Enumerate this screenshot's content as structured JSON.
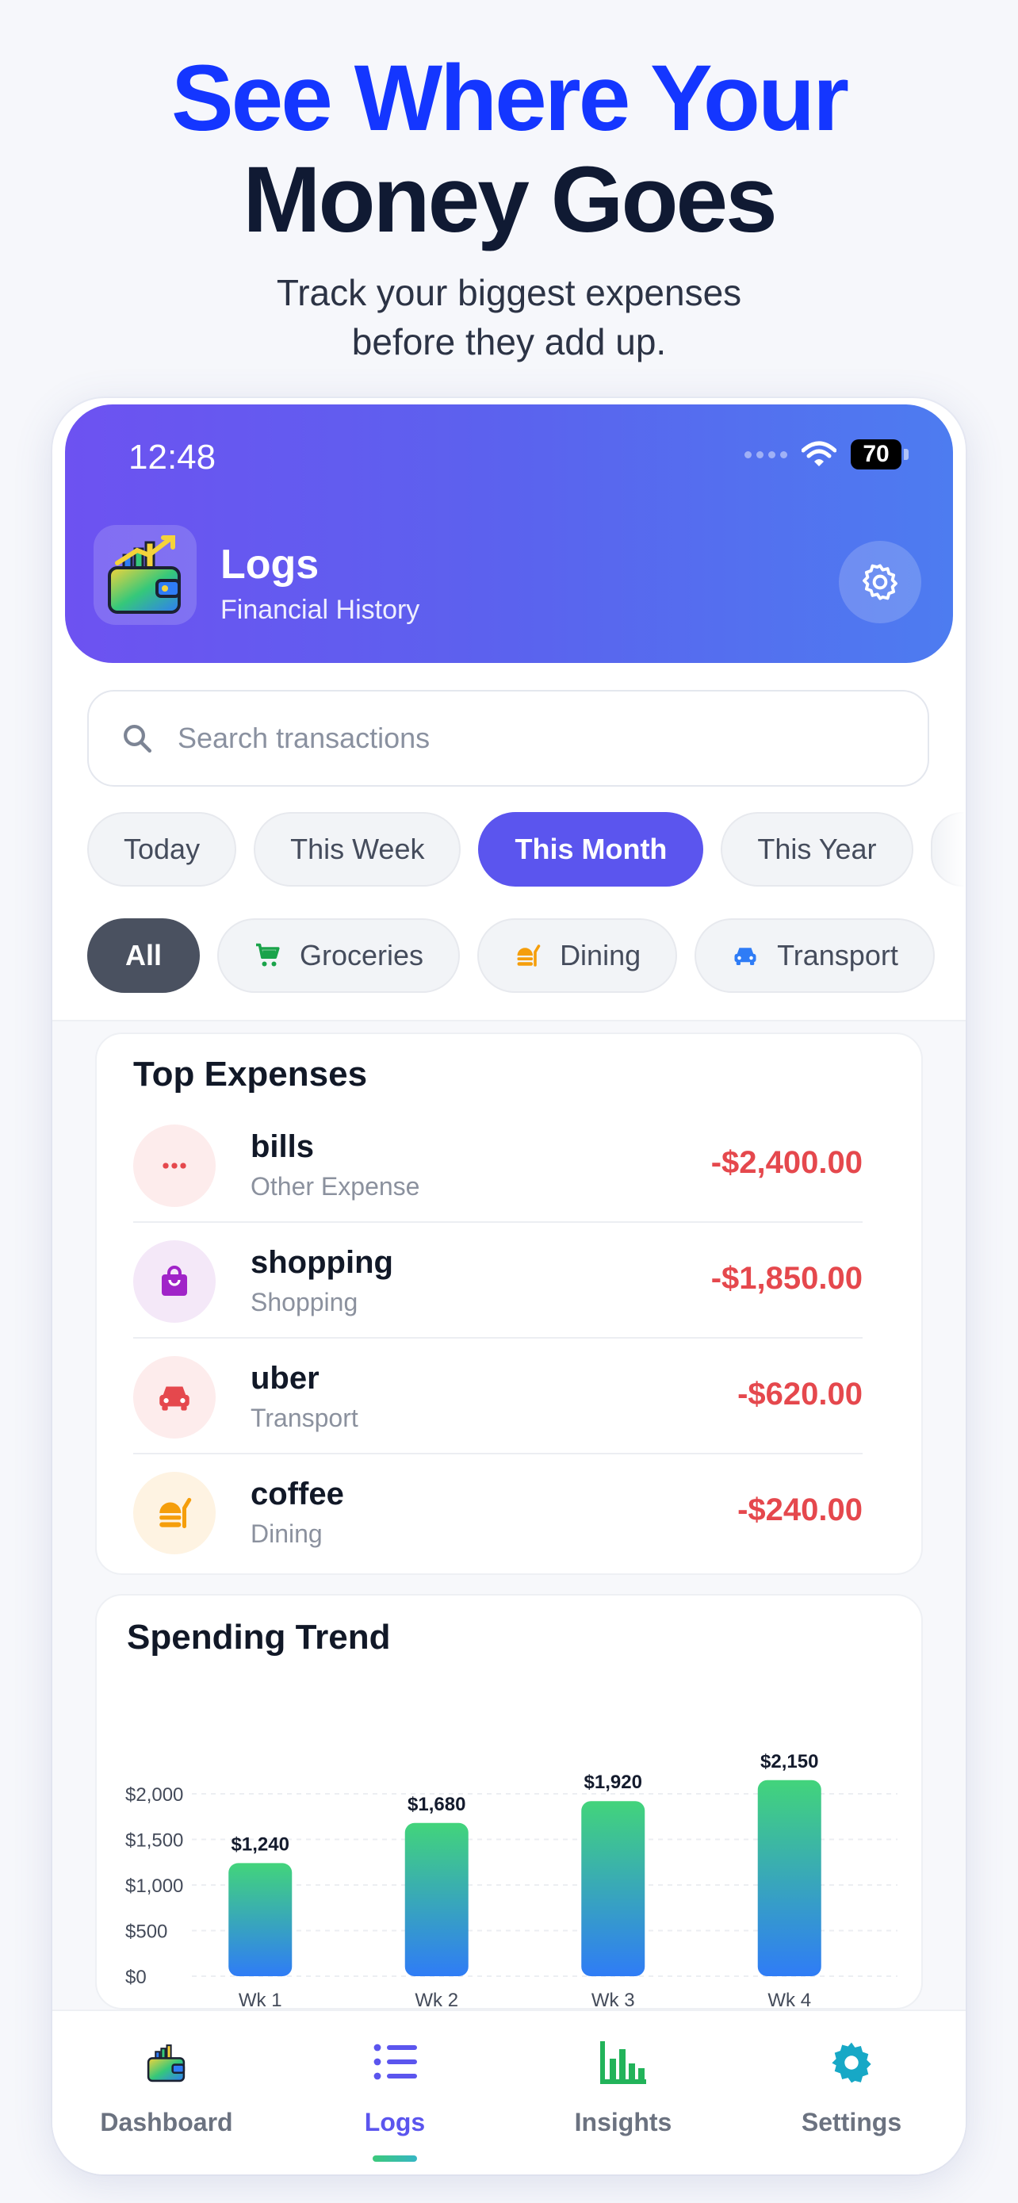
{
  "hero": {
    "line1": "See Where Your",
    "line2": "Money Goes",
    "subtitle_line1": "Track your biggest expenses",
    "subtitle_line2": "before they add up."
  },
  "status_bar": {
    "time": "12:48",
    "battery": "70"
  },
  "header": {
    "title": "Logs",
    "subtitle": "Financial History"
  },
  "search": {
    "placeholder": "Search transactions",
    "value": ""
  },
  "period_filters": [
    {
      "label": "Today",
      "active": false
    },
    {
      "label": "This Week",
      "active": false
    },
    {
      "label": "This Month",
      "active": true
    },
    {
      "label": "This Year",
      "active": false
    }
  ],
  "category_filters": [
    {
      "label": "All",
      "active": true,
      "icon": ""
    },
    {
      "label": "Groceries",
      "active": false,
      "icon": "cart-icon"
    },
    {
      "label": "Dining",
      "active": false,
      "icon": "food-icon"
    },
    {
      "label": "Transport",
      "active": false,
      "icon": "car-icon"
    }
  ],
  "top_expenses": {
    "title": "Top Expenses",
    "items": [
      {
        "name": "bills",
        "category": "Other Expense",
        "amount": "-$2,400.00",
        "icon": "more-icon",
        "icon_color": "#e5484d",
        "icon_bg": "#fdecec"
      },
      {
        "name": "shopping",
        "category": "Shopping",
        "amount": "-$1,850.00",
        "icon": "shopping-bag-icon",
        "icon_color": "#a024c8",
        "icon_bg": "#f4e8f8"
      },
      {
        "name": "uber",
        "category": "Transport",
        "amount": "-$620.00",
        "icon": "car-icon",
        "icon_color": "#e5484d",
        "icon_bg": "#fdecec"
      },
      {
        "name": "coffee",
        "category": "Dining",
        "amount": "-$240.00",
        "icon": "food-icon",
        "icon_color": "#f59e0b",
        "icon_bg": "#fef3e2"
      }
    ]
  },
  "spending_trend": {
    "title": "Spending Trend"
  },
  "chart_data": {
    "type": "bar",
    "categories": [
      "Wk 1",
      "Wk 2",
      "Wk 3",
      "Wk 4"
    ],
    "values": [
      1240,
      1680,
      1920,
      2150
    ],
    "value_labels": [
      "$1,240",
      "$1,680",
      "$1,920",
      "$2,150"
    ],
    "y_ticks": [
      0,
      500,
      1000,
      1500,
      2000
    ],
    "y_tick_labels": [
      "$0",
      "$500",
      "$1,000",
      "$1,500",
      "$2,000"
    ],
    "ylim": [
      0,
      2000
    ],
    "grid": true,
    "title": "Spending Trend",
    "xlabel": "",
    "ylabel": "",
    "bar_gradient": [
      "#42d47b",
      "#2f7cf6"
    ]
  },
  "colors": {
    "accent": "#5b55ee",
    "hero_blue": "#1436ff",
    "negative": "#e5484d",
    "header_gradient": [
      "#6d52f1",
      "#4d7cf0"
    ]
  },
  "tabs": [
    {
      "label": "Dashboard",
      "icon": "wallet-icon",
      "active": false
    },
    {
      "label": "Logs",
      "icon": "list-icon",
      "active": true
    },
    {
      "label": "Insights",
      "icon": "bar-chart-icon",
      "active": false
    },
    {
      "label": "Settings",
      "icon": "gear-icon",
      "active": false
    }
  ]
}
